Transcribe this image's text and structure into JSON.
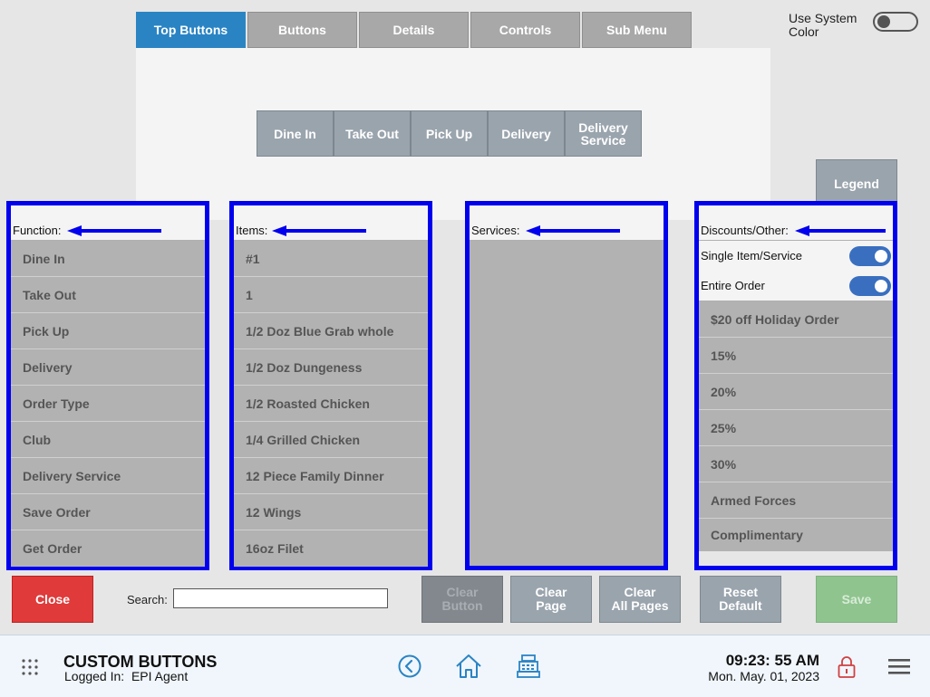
{
  "tabs": [
    "Top Buttons",
    "Buttons",
    "Details",
    "Controls",
    "Sub Menu"
  ],
  "system_color": {
    "label_line1": "Use System",
    "label_line2": "Color"
  },
  "preview_buttons": [
    {
      "line1": "Dine In",
      "line2": ""
    },
    {
      "line1": "Take Out",
      "line2": ""
    },
    {
      "line1": "Pick Up",
      "line2": ""
    },
    {
      "line1": "Delivery",
      "line2": ""
    },
    {
      "line1": "Delivery",
      "line2": "Service"
    }
  ],
  "legend_label": "Legend",
  "panels": {
    "function": {
      "header": "Function:",
      "items": [
        "Dine In",
        "Take Out",
        "Pick Up",
        "Delivery",
        "Order Type",
        "Club",
        "Delivery Service",
        "Save Order",
        "Get Order"
      ]
    },
    "items": {
      "header": "Items:",
      "items": [
        "#1",
        "1",
        "1/2 Doz Blue Grab whole",
        "1/2 Doz Dungeness",
        "1/2 Roasted Chicken",
        "1/4 Grilled Chicken",
        "12 Piece Family Dinner",
        "12 Wings",
        "16oz Filet"
      ]
    },
    "services": {
      "header": "Services:",
      "items": []
    },
    "discounts": {
      "header": "Discounts/Other:",
      "options": [
        {
          "label": "Single Item/Service",
          "on": true
        },
        {
          "label": "Entire Order",
          "on": true
        }
      ],
      "items": [
        "$20 off Holiday Order",
        "15%",
        "20%",
        "25%",
        "30%",
        "Armed Forces",
        "Complimentary"
      ]
    }
  },
  "bottom": {
    "close": "Close",
    "search_label": "Search:",
    "search_value": "",
    "clear_button": {
      "line1": "Clear",
      "line2": "Button"
    },
    "clear_page": {
      "line1": "Clear",
      "line2": "Page"
    },
    "clear_all_pages": {
      "line1": "Clear",
      "line2": "All Pages"
    },
    "reset_default": {
      "line1": "Reset",
      "line2": "Default"
    },
    "save": "Save"
  },
  "footer": {
    "title": "CUSTOM BUTTONS",
    "logged_in_label": "Logged In:",
    "user": "EPI Agent",
    "time": "09:23: 55 AM",
    "date": "Mon. May. 01, 2023"
  },
  "colors": {
    "accent": "#2a84c4",
    "panel_border": "#0000ee",
    "close": "#e03a3a",
    "save": "#8fc48f",
    "button_gray": "#9aa4ad",
    "toggle_on": "#3a6fc0"
  },
  "icons": [
    "apps-grid-icon",
    "back-circle-icon",
    "home-icon",
    "register-icon",
    "lock-icon",
    "hamburger-menu-icon"
  ]
}
